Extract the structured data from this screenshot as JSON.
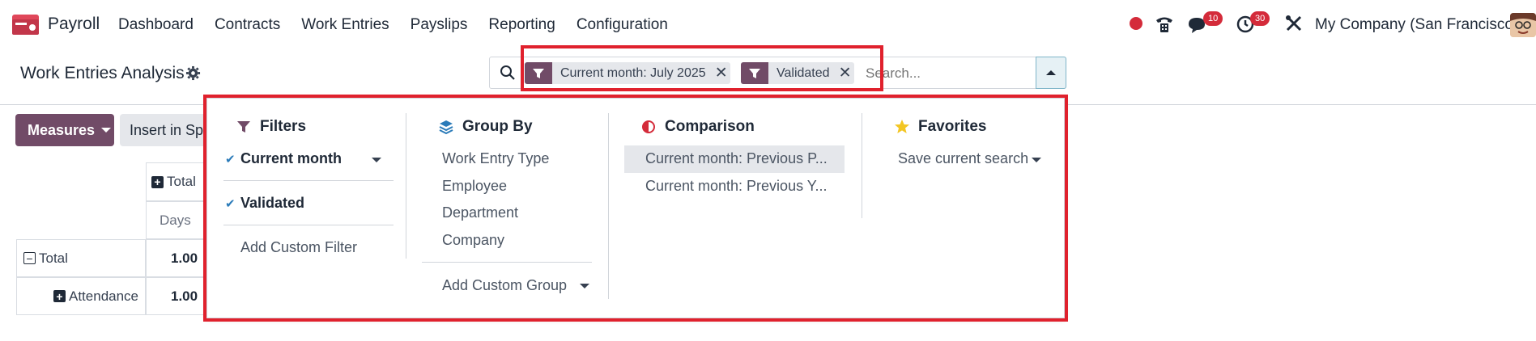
{
  "navbar": {
    "app_name": "Payroll",
    "menu": [
      "Dashboard",
      "Contracts",
      "Work Entries",
      "Payslips",
      "Reporting",
      "Configuration"
    ],
    "chat_count": "10",
    "activity_count": "30",
    "company": "My Company (San Francisco)"
  },
  "control_panel": {
    "title": "Work Entries Analysis",
    "facets": [
      {
        "label": "Current month: July 2025"
      },
      {
        "label": "Validated"
      }
    ],
    "search_placeholder": "Search..."
  },
  "buttons": {
    "measures": "Measures",
    "insert": "Insert in Spreadsheet"
  },
  "pivot": {
    "col_header": "Total",
    "measure": "Days",
    "rows": [
      {
        "label": "Total",
        "value": "1.00"
      },
      {
        "label": "Attendance",
        "value": "1.00"
      }
    ]
  },
  "dropdown": {
    "filters": {
      "title": "Filters",
      "items": [
        "Current month",
        "Validated"
      ],
      "add": "Add Custom Filter"
    },
    "group_by": {
      "title": "Group By",
      "items": [
        "Work Entry Type",
        "Employee",
        "Department",
        "Company"
      ],
      "add": "Add Custom Group"
    },
    "comparison": {
      "title": "Comparison",
      "items": [
        "Current month: Previous P...",
        "Current month: Previous Y..."
      ]
    },
    "favorites": {
      "title": "Favorites",
      "save": "Save current search"
    }
  },
  "colors": {
    "brand": "#714b67",
    "highlight_border": "#e0212d",
    "badge": "#d42b3a",
    "check": "#2b7bb9"
  }
}
